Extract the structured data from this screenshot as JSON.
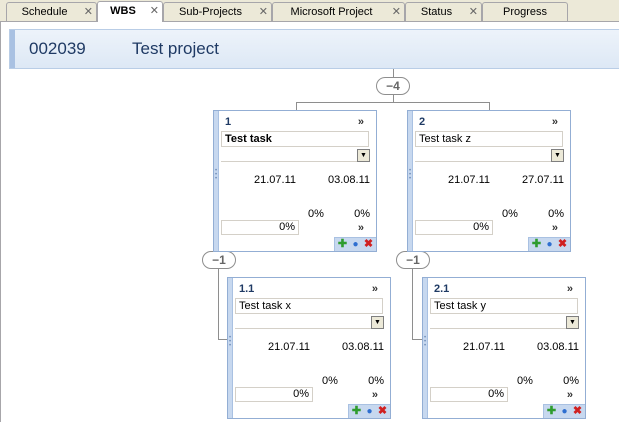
{
  "tabs": [
    {
      "label": "Schedule",
      "close": "✕"
    },
    {
      "label": "WBS",
      "close": "✕"
    },
    {
      "label": "Sub-Projects",
      "close": "✕"
    },
    {
      "label": "Microsoft Project",
      "close": "✕"
    },
    {
      "label": "Status",
      "close": "✕"
    },
    {
      "label": "Progress",
      "close": ""
    }
  ],
  "active_tab": "WBS",
  "project": {
    "id": "002039",
    "name": "Test project"
  },
  "badges": {
    "root": "−4",
    "task1": "−1",
    "task2": "−1"
  },
  "cards": [
    {
      "wbs": "1",
      "more": "»",
      "name": "Test task",
      "start": "21.07.11",
      "end": "03.08.11",
      "pct_a": "0%",
      "pct_b": "0%",
      "pct_box": "0%",
      "pct_more": "»"
    },
    {
      "wbs": "2",
      "more": "»",
      "name": "Test task z",
      "start": "21.07.11",
      "end": "27.07.11",
      "pct_a": "0%",
      "pct_b": "0%",
      "pct_box": "0%",
      "pct_more": "»"
    },
    {
      "wbs": "1.1",
      "more": "»",
      "name": "Test task x",
      "start": "21.07.11",
      "end": "03.08.11",
      "pct_a": "0%",
      "pct_b": "0%",
      "pct_box": "0%",
      "pct_more": "»"
    },
    {
      "wbs": "2.1",
      "more": "»",
      "name": "Test task y",
      "start": "21.07.11",
      "end": "03.08.11",
      "pct_a": "0%",
      "pct_b": "0%",
      "pct_box": "0%",
      "pct_more": "»"
    }
  ],
  "icons": {
    "dropdown": "dropdown-arrow-icon",
    "add": "add-icon",
    "info": "info-icon",
    "delete": "delete-icon"
  },
  "colors": {
    "accent": "#1f3a64",
    "card_border": "#93aed4",
    "header_bg": "#dde8f5"
  }
}
